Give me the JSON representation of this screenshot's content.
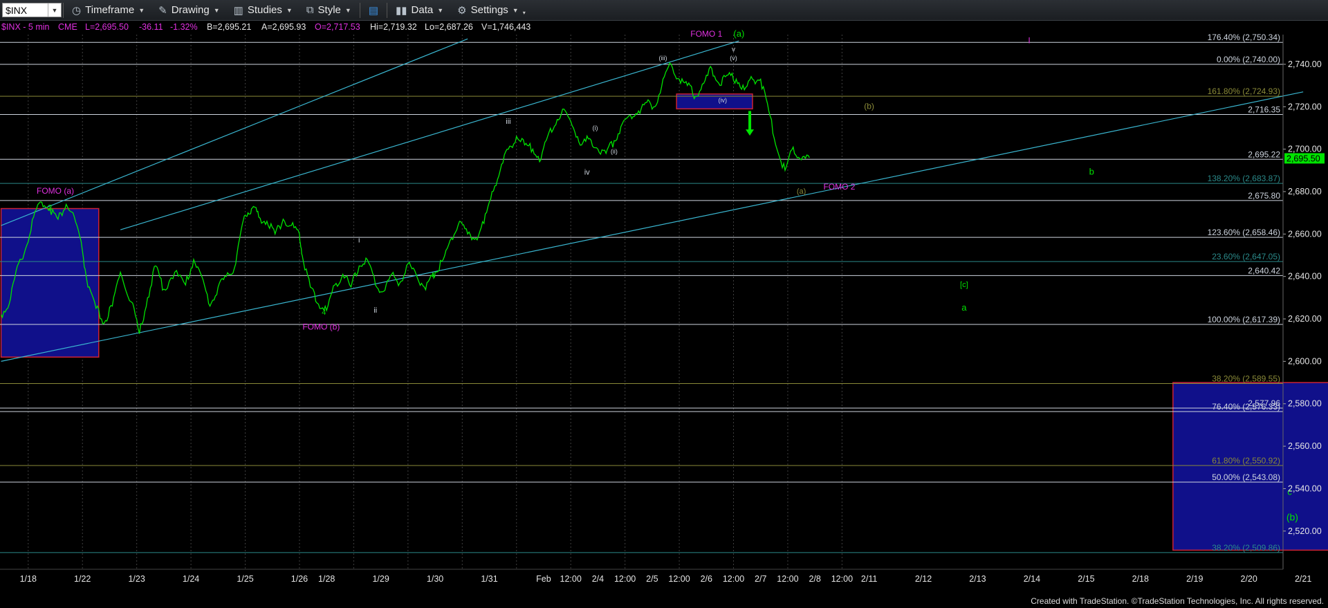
{
  "toolbar": {
    "symbol": "$INX",
    "items": [
      {
        "label": "Timeframe"
      },
      {
        "label": "Drawing"
      },
      {
        "label": "Studies"
      },
      {
        "label": "Style"
      },
      {
        "label": ""
      },
      {
        "label": "Data"
      },
      {
        "label": "Settings"
      }
    ]
  },
  "info_bar": {
    "symbol_label": "$INX - 5 min",
    "exchange": "CME",
    "last": "L=2,695.50",
    "change": "-36.11",
    "change_pct": "-1.32%",
    "bid": "B=2,695.21",
    "ask": "A=2,695.93",
    "open": "O=2,717.53",
    "high": "Hi=2,719.32",
    "low": "Lo=2,687.26",
    "volume": "V=1,746,443"
  },
  "footer": "Created with TradeStation. ©TradeStation Technologies, Inc. All rights reserved.",
  "colors": {
    "price": "#00e400",
    "fib_white": "#cfd6e0",
    "fib_olive": "#8a8a38",
    "fib_teal": "#2b8a8a",
    "channel": "#3ab6d0",
    "magenta": "#e030e0",
    "box": "#10108a",
    "box_border": "#cc2233",
    "grid": "#404040"
  },
  "chart_data": {
    "type": "line",
    "title": "",
    "xlabel": "",
    "ylabel": "",
    "ylim": [
      2502,
      2754
    ],
    "y_ticks": [
      2520,
      2540,
      2560,
      2580,
      2600,
      2620,
      2640,
      2660,
      2680,
      2700,
      2720,
      2740
    ],
    "y_tick_labels": [
      "2,520.00",
      "2,540.00",
      "2,560.00",
      "2,580.00",
      "2,600.00",
      "2,620.00",
      "2,640.00",
      "2,660.00",
      "2,680.00",
      "2,700.00",
      "2,720.00",
      "2,740.00"
    ],
    "x_labels": [
      {
        "i": 0.5,
        "label": "1/18"
      },
      {
        "i": 1.5,
        "label": "1/22"
      },
      {
        "i": 2.5,
        "label": "1/23"
      },
      {
        "i": 3.5,
        "label": "1/24"
      },
      {
        "i": 4.5,
        "label": "1/25"
      },
      {
        "i": 5.5,
        "label": "1/26"
      },
      {
        "i": 6.0,
        "label": "1/28"
      },
      {
        "i": 7.0,
        "label": "1/29"
      },
      {
        "i": 8.0,
        "label": "1/30"
      },
      {
        "i": 9.0,
        "label": "1/31"
      },
      {
        "i": 10.0,
        "label": "Feb"
      },
      {
        "i": 10.5,
        "label": "12:00"
      },
      {
        "i": 11.0,
        "label": "2/4"
      },
      {
        "i": 11.5,
        "label": "12:00"
      },
      {
        "i": 12.0,
        "label": "2/5"
      },
      {
        "i": 12.5,
        "label": "12:00"
      },
      {
        "i": 13.0,
        "label": "2/6"
      },
      {
        "i": 13.5,
        "label": "12:00"
      },
      {
        "i": 14.0,
        "label": "2/7"
      },
      {
        "i": 14.5,
        "label": "12:00"
      },
      {
        "i": 15.0,
        "label": "2/8"
      },
      {
        "i": 15.5,
        "label": "12:00"
      },
      {
        "i": 16.0,
        "label": "2/11"
      },
      {
        "i": 17.0,
        "label": "2/12"
      },
      {
        "i": 18.0,
        "label": "2/13"
      },
      {
        "i": 19.0,
        "label": "2/14"
      },
      {
        "i": 20.0,
        "label": "2/15"
      },
      {
        "i": 21.0,
        "label": "2/18"
      },
      {
        "i": 22.0,
        "label": "2/19"
      },
      {
        "i": 23.0,
        "label": "2/20"
      },
      {
        "i": 24.0,
        "label": "2/21"
      }
    ],
    "x_gridlines": [
      0.5,
      1.5,
      2.5,
      3.5,
      4.5,
      5.5,
      6.5,
      7.5,
      8.5,
      9.5,
      10.5,
      11.5,
      12.5,
      13.5,
      14.5,
      15.5
    ],
    "series": [
      {
        "x": [
          0,
          0.15,
          0.3,
          0.45,
          0.6,
          0.75,
          0.9,
          1.05,
          1.2,
          1.35,
          1.5,
          1.6,
          1.75,
          1.9,
          2.05,
          2.2,
          2.4,
          2.55,
          2.7,
          2.85,
          3.0,
          3.2,
          3.4,
          3.55,
          3.7,
          3.85,
          4.0,
          4.15,
          4.3,
          4.45,
          4.55,
          4.65,
          4.75,
          4.9,
          5.05,
          5.2,
          5.35,
          5.5,
          5.55,
          5.7,
          5.85,
          6.0,
          6.15,
          6.3,
          6.45,
          6.6,
          6.75,
          6.9,
          7.05,
          7.2,
          7.35,
          7.5,
          7.65,
          7.8,
          7.95,
          8.0,
          8.15,
          8.3,
          8.45,
          8.6,
          8.75,
          8.9,
          9.05,
          9.2,
          9.35,
          9.5,
          9.65,
          9.8,
          9.95,
          10.1,
          10.25,
          10.4,
          10.55,
          10.7,
          10.85,
          11.0,
          11.15,
          11.3,
          11.45,
          11.6,
          11.75,
          11.9,
          12.05,
          12.2,
          12.35,
          12.5,
          12.65,
          12.8,
          12.95,
          13.1,
          13.25,
          13.4,
          13.55,
          13.7,
          13.85,
          14.0,
          14.15,
          14.3,
          14.45,
          14.6,
          14.75,
          14.9
        ],
        "y": [
          2622,
          2627,
          2645,
          2653,
          2668,
          2675,
          2672,
          2667,
          2674,
          2668,
          2652,
          2635,
          2625,
          2618,
          2626,
          2642,
          2628,
          2613,
          2630,
          2645,
          2634,
          2642,
          2636,
          2648,
          2640,
          2626,
          2635,
          2640,
          2644,
          2665,
          2670,
          2673,
          2668,
          2666,
          2660,
          2667,
          2664,
          2660,
          2650,
          2635,
          2627,
          2624,
          2636,
          2641,
          2635,
          2645,
          2648,
          2636,
          2633,
          2641,
          2637,
          2646,
          2641,
          2635,
          2640,
          2642,
          2648,
          2658,
          2666,
          2660,
          2658,
          2665,
          2680,
          2690,
          2700,
          2706,
          2702,
          2700,
          2695,
          2708,
          2714,
          2718,
          2710,
          2702,
          2705,
          2700,
          2698,
          2704,
          2712,
          2716,
          2718,
          2722,
          2720,
          2733,
          2740,
          2733,
          2730,
          2725,
          2731,
          2738,
          2730,
          2735,
          2733,
          2728,
          2733,
          2733,
          2718,
          2700,
          2690,
          2701,
          2695,
          2696
        ]
      }
    ],
    "fib_lines": [
      {
        "y": 2750.34,
        "label": "176.40% (2,750.34)",
        "color": "white"
      },
      {
        "y": 2740.0,
        "label": "0.00% (2,740.00)",
        "color": "white"
      },
      {
        "y": 2724.93,
        "label": "161.80% (2,724.93)",
        "color": "olive"
      },
      {
        "y": 2716.35,
        "label": "2,716.35",
        "color": "white"
      },
      {
        "y": 2695.22,
        "label": "2,695.22",
        "color": "white"
      },
      {
        "y": 2683.87,
        "label": "138.20% (2,683.87)",
        "color": "teal"
      },
      {
        "y": 2675.8,
        "label": "2,675.80",
        "color": "white"
      },
      {
        "y": 2658.46,
        "label": "123.60% (2,658.46)",
        "color": "white"
      },
      {
        "y": 2647.05,
        "label": "23.60% (2,647.05)",
        "color": "teal"
      },
      {
        "y": 2640.42,
        "label": "2,640.42",
        "color": "white"
      },
      {
        "y": 2617.39,
        "label": "100.00% (2,617.39)",
        "color": "white"
      },
      {
        "y": 2589.55,
        "label": "38.20% (2,589.55)",
        "color": "olive"
      },
      {
        "y": 2577.96,
        "label": "2,577.96",
        "color": "white"
      },
      {
        "y": 2576.33,
        "label": "76.40% (2,576.33)",
        "color": "white"
      },
      {
        "y": 2550.92,
        "label": "61.80% (2,550.92)",
        "color": "olive"
      },
      {
        "y": 2543.08,
        "label": "50.00% (2,543.08)",
        "color": "white"
      },
      {
        "y": 2509.86,
        "label": "38.20% (2,509.86)",
        "color": "teal"
      }
    ],
    "last_price_marker": {
      "y": 2695.5,
      "label": "2,695.50"
    },
    "channel_lines": [
      {
        "x1": 0,
        "y1": 2600,
        "x2": 24,
        "y2": 2727
      },
      {
        "x1": 2.2,
        "y1": 2662,
        "x2": 13.6,
        "y2": 2751
      },
      {
        "x1": 0,
        "y1": 2664,
        "x2": 8.6,
        "y2": 2752
      }
    ],
    "boxes": [
      {
        "x1": 0,
        "x2": 1.8,
        "y1": 2602,
        "y2": 2672
      },
      {
        "x1": 12.45,
        "x2": 13.85,
        "y1": 2719,
        "y2": 2726
      },
      {
        "x1": 21.6,
        "x2": 24.6,
        "y1": 2511,
        "y2": 2590
      }
    ],
    "annotations": [
      {
        "text": "FOMO (a)",
        "x": 1.0,
        "y": 2679,
        "color": "magenta",
        "size": 12
      },
      {
        "text": "3",
        "x": 0.9,
        "y": 2671,
        "color": "lime",
        "size": 12
      },
      {
        "text": "FOMO (b)",
        "x": 5.9,
        "y": 2615,
        "color": "magenta",
        "size": 12
      },
      {
        "text": "4",
        "x": 5.95,
        "y": 2622,
        "color": "lime",
        "size": 11
      },
      {
        "text": "i",
        "x": 6.6,
        "y": 2656,
        "color": "white",
        "size": 11
      },
      {
        "text": "ii",
        "x": 6.9,
        "y": 2623,
        "color": "white",
        "size": 11
      },
      {
        "text": "iii",
        "x": 9.35,
        "y": 2712,
        "color": "white",
        "size": 11
      },
      {
        "text": "iv",
        "x": 10.8,
        "y": 2688,
        "color": "white",
        "size": 11
      },
      {
        "text": "(i)",
        "x": 10.95,
        "y": 2709,
        "color": "white",
        "size": 9
      },
      {
        "text": "(ii)",
        "x": 11.3,
        "y": 2698,
        "color": "white",
        "size": 9
      },
      {
        "text": "(iii)",
        "x": 12.2,
        "y": 2742,
        "color": "white",
        "size": 9
      },
      {
        "text": "(iv)",
        "x": 13.3,
        "y": 2722,
        "color": "white",
        "size": 9
      },
      {
        "text": "(v)",
        "x": 13.5,
        "y": 2742,
        "color": "white",
        "size": 9
      },
      {
        "text": "v",
        "x": 13.5,
        "y": 2746,
        "color": "white",
        "size": 10
      },
      {
        "text": "FOMO 1",
        "x": 13.0,
        "y": 2753,
        "color": "magenta",
        "size": 12
      },
      {
        "text": "(a)",
        "x": 13.6,
        "y": 2753,
        "color": "lime",
        "size": 13
      },
      {
        "text": "(b)",
        "x": 16.0,
        "y": 2719,
        "color": "olive",
        "size": 12
      },
      {
        "text": "(a)",
        "x": 14.75,
        "y": 2679,
        "color": "olive",
        "size": 11
      },
      {
        "text": "FOMO 2",
        "x": 15.45,
        "y": 2681,
        "color": "magenta",
        "size": 12
      },
      {
        "text": "b",
        "x": 20.1,
        "y": 2688,
        "color": "lime",
        "size": 13
      },
      {
        "text": "[c]",
        "x": 17.75,
        "y": 2635,
        "color": "lime",
        "size": 11
      },
      {
        "text": "a",
        "x": 17.75,
        "y": 2624,
        "color": "lime",
        "size": 13
      },
      {
        "text": "I",
        "x": 18.95,
        "y": 2750,
        "color": "magenta",
        "size": 12
      },
      {
        "text": "c",
        "x": 23.75,
        "y": 2537,
        "color": "lime",
        "size": 13
      },
      {
        "text": "(b)",
        "x": 23.8,
        "y": 2525,
        "color": "lime",
        "size": 14
      }
    ],
    "arrow": {
      "x": 13.8,
      "y_from": 2718,
      "y_to": 2707
    }
  }
}
